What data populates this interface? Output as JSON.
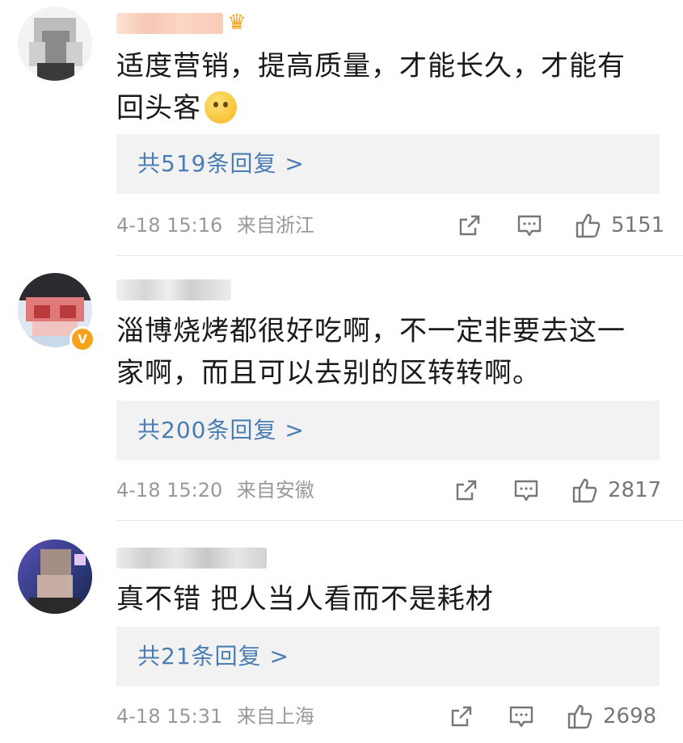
{
  "comments": [
    {
      "content_line1": "适度营销，提高质量，才能长久，才能有",
      "content_line2": "回头客",
      "emoji_icon": "thinking-face-emoji",
      "badge_icon": "crown-badge-icon",
      "reply_label": "共519条回复 >",
      "time": "4-18 15:16",
      "location": "来自浙江",
      "likes": "5151"
    },
    {
      "content_line1": "淄博烧烤都很好吃啊，不一定非要去这一",
      "content_line2": "家啊，而且可以去别的区转转啊。",
      "verified_badge": "V",
      "reply_label": "共200条回复 >",
      "time": "4-18 15:20",
      "location": "来自安徽",
      "likes": "2817"
    },
    {
      "content_line1": "真不错 把人当人看而不是耗材",
      "reply_label": "共21条回复 >",
      "time": "4-18 15:31",
      "location": "来自上海",
      "likes": "2698"
    }
  ],
  "colors": {
    "link": "#4a7db4",
    "meta": "#999999",
    "reply_bg": "#f2f2f2",
    "badge": "#f7a21b"
  }
}
